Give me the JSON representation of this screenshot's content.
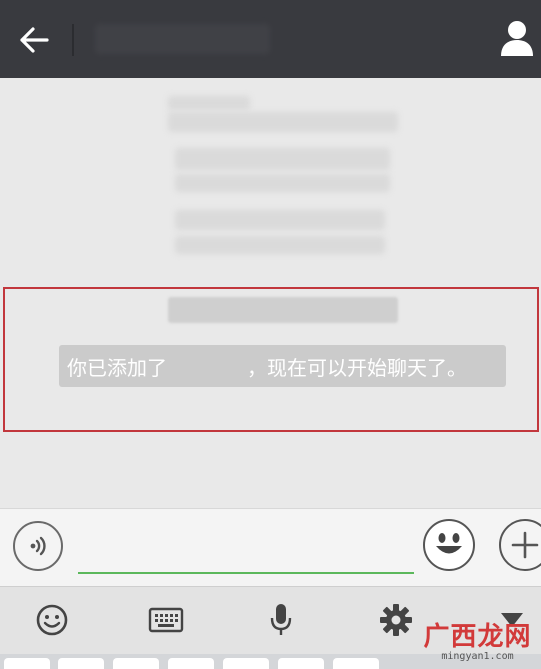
{
  "header": {
    "back_icon": "arrow-left-icon",
    "profile_icon": "person-icon"
  },
  "chat": {
    "system_message": {
      "prefix": "你已添加了",
      "suffix": "，现在可以开始聊天了。"
    }
  },
  "input_bar": {
    "voice_icon": "voice-icon",
    "text_value": "",
    "emoji_icon": "emoji-icon",
    "plus_icon": "plus-icon"
  },
  "keyboard_toolbar": {
    "items": [
      "emoji-icon",
      "keyboard-icon",
      "microphone-icon",
      "gear-icon",
      "collapse-triangle-icon"
    ]
  },
  "watermark": {
    "logo": "广西龙网",
    "url": "mingyan1.com"
  },
  "colors": {
    "topbar": "#393a3f",
    "chat_bg": "#e9e9e9",
    "highlight_border": "#c2373d",
    "input_underline": "#5cb85c",
    "watermark_red": "#d23a3a"
  }
}
